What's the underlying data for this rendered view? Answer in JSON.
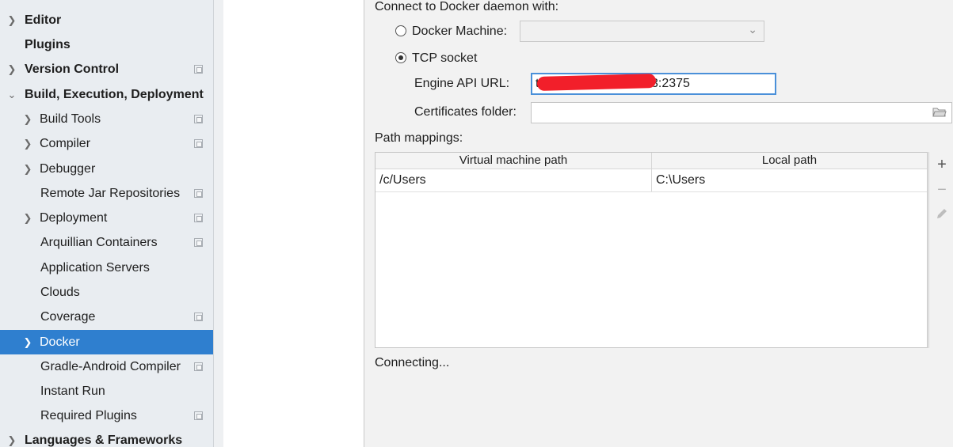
{
  "sidebar": {
    "items": [
      {
        "label": "Editor",
        "bold": true,
        "chevron": true
      },
      {
        "label": "Plugins",
        "bold": true,
        "chevron": false
      },
      {
        "label": "Version Control",
        "bold": true,
        "chevron": true,
        "copy_icon": true
      },
      {
        "label": "Build, Execution, Deployment",
        "bold": true,
        "chevron": "down"
      },
      {
        "label": "Build Tools",
        "chevron": true,
        "copy_icon": true
      },
      {
        "label": "Compiler",
        "chevron": true,
        "copy_icon": true
      },
      {
        "label": "Debugger",
        "chevron": true
      },
      {
        "label": "Remote Jar Repositories",
        "copy_icon": true
      },
      {
        "label": "Deployment",
        "chevron": true,
        "copy_icon": true
      },
      {
        "label": "Arquillian Containers",
        "copy_icon": true
      },
      {
        "label": "Application Servers"
      },
      {
        "label": "Clouds"
      },
      {
        "label": "Coverage",
        "copy_icon": true
      },
      {
        "label": "Docker",
        "chevron": true,
        "selected": true
      },
      {
        "label": "Gradle-Android Compiler",
        "copy_icon": true
      },
      {
        "label": "Instant Run"
      },
      {
        "label": "Required Plugins",
        "copy_icon": true
      },
      {
        "label": "Languages & Frameworks",
        "bold": true,
        "chevron": true
      }
    ]
  },
  "docker": {
    "connect_label": "Connect to Docker daemon with:",
    "docker_machine_label": "Docker Machine:",
    "docker_machine_value": "",
    "tcp_socket_label": "TCP socket",
    "selected_connection": "TCP socket",
    "engine_api_url_label": "Engine API URL:",
    "engine_api_url_visible_start": "tc",
    "engine_api_url_visible_end": "3:2375",
    "certificates_folder_label": "Certificates folder:",
    "certificates_folder_value": "",
    "path_mappings_label": "Path mappings:",
    "columns": [
      "Virtual machine path",
      "Local path"
    ],
    "rows": [
      {
        "vm_path": "/c/Users",
        "local_path": "C:\\Users"
      }
    ],
    "status": "Connecting..."
  },
  "icons": {
    "chevron_right": "›",
    "chevron_down": "⌄",
    "add": "+",
    "remove": "−",
    "edit": "pencil-icon",
    "folder": "folder-icon",
    "copy": "copy-icon"
  },
  "colors": {
    "sidebar_bg": "#e9edf1",
    "selected_bg": "#2f7fcf",
    "panel_bg": "#f2f2f2",
    "focus_border": "#4a90d9",
    "redaction": "#f21f2a"
  }
}
